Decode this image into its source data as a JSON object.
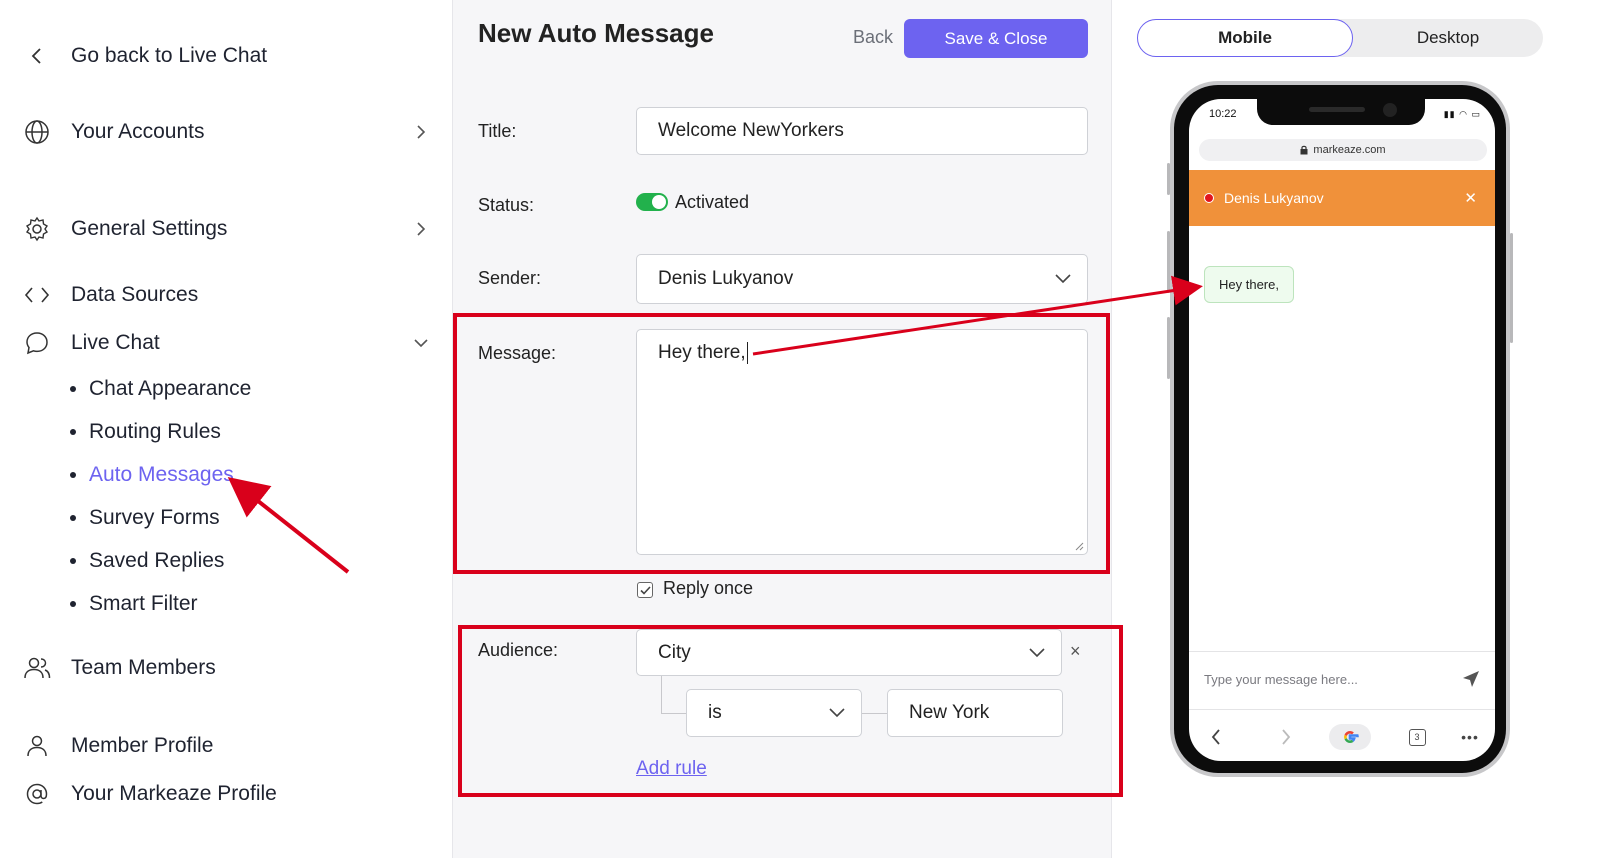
{
  "sidebar": {
    "back": "Go back to Live Chat",
    "accounts": "Your Accounts",
    "general_settings": "General Settings",
    "data_sources": "Data Sources",
    "live_chat": "Live Chat",
    "sub_items": [
      "Chat Appearance",
      "Routing Rules",
      "Auto Messages",
      "Survey Forms",
      "Saved Replies",
      "Smart Filter"
    ],
    "active_sub_item": "Auto Messages",
    "team_members": "Team Members",
    "member_profile": "Member Profile",
    "markeaze_profile": "Your Markeaze Profile"
  },
  "form": {
    "title": "New Auto Message",
    "back_label": "Back",
    "save_label": "Save & Close",
    "title_label": "Title:",
    "title_value": "Welcome NewYorkers",
    "status_label": "Status:",
    "status_value": "Activated",
    "status_on": true,
    "sender_label": "Sender:",
    "sender_value": "Denis Lukyanov",
    "message_label": "Message:",
    "message_value": "Hey there,",
    "reply_once_label": "Reply once",
    "reply_once_checked": true,
    "audience_label": "Audience:",
    "audience_field": "City",
    "audience_operator": "is",
    "audience_value": "New York",
    "add_rule_label": "Add rule",
    "remove_label": "×"
  },
  "preview": {
    "tabs": [
      "Mobile",
      "Desktop"
    ],
    "active_tab": "Mobile",
    "phone": {
      "time": "10:22",
      "url": "markeaze.com",
      "chat_header_name": "Denis Lukyanov",
      "bubble_text": "Hey there,",
      "input_placeholder": "Type your message here...",
      "tab_count": "3"
    }
  },
  "colors": {
    "accent": "#6d63f0",
    "annotation_red": "#d9001b",
    "toggle_green": "#22b14c",
    "chat_header": "#f0913a"
  }
}
